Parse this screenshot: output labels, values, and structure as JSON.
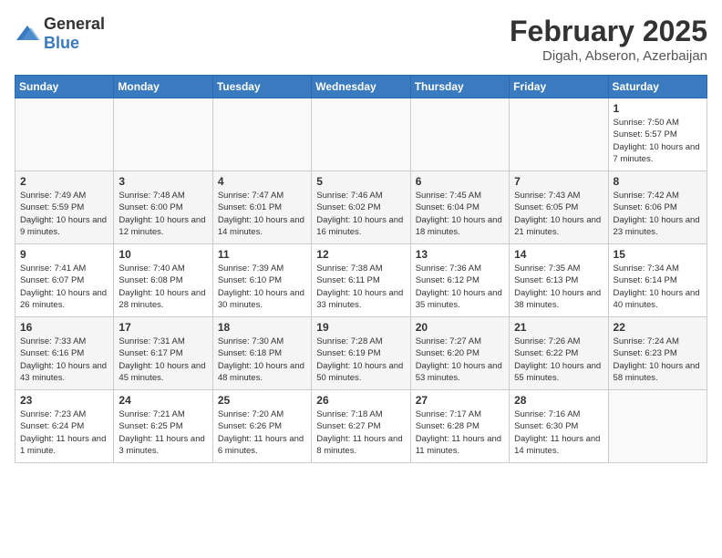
{
  "header": {
    "logo_general": "General",
    "logo_blue": "Blue",
    "title": "February 2025",
    "location": "Digah, Abseron, Azerbaijan"
  },
  "calendar": {
    "weekdays": [
      "Sunday",
      "Monday",
      "Tuesday",
      "Wednesday",
      "Thursday",
      "Friday",
      "Saturday"
    ],
    "weeks": [
      [
        {
          "day": "",
          "sunrise": "",
          "sunset": "",
          "daylight": "",
          "empty": true
        },
        {
          "day": "",
          "sunrise": "",
          "sunset": "",
          "daylight": "",
          "empty": true
        },
        {
          "day": "",
          "sunrise": "",
          "sunset": "",
          "daylight": "",
          "empty": true
        },
        {
          "day": "",
          "sunrise": "",
          "sunset": "",
          "daylight": "",
          "empty": true
        },
        {
          "day": "",
          "sunrise": "",
          "sunset": "",
          "daylight": "",
          "empty": true
        },
        {
          "day": "",
          "sunrise": "",
          "sunset": "",
          "daylight": "",
          "empty": true
        },
        {
          "day": "1",
          "sunrise": "Sunrise: 7:50 AM",
          "sunset": "Sunset: 5:57 PM",
          "daylight": "Daylight: 10 hours and 7 minutes.",
          "empty": false
        }
      ],
      [
        {
          "day": "2",
          "sunrise": "Sunrise: 7:49 AM",
          "sunset": "Sunset: 5:59 PM",
          "daylight": "Daylight: 10 hours and 9 minutes.",
          "empty": false
        },
        {
          "day": "3",
          "sunrise": "Sunrise: 7:48 AM",
          "sunset": "Sunset: 6:00 PM",
          "daylight": "Daylight: 10 hours and 12 minutes.",
          "empty": false
        },
        {
          "day": "4",
          "sunrise": "Sunrise: 7:47 AM",
          "sunset": "Sunset: 6:01 PM",
          "daylight": "Daylight: 10 hours and 14 minutes.",
          "empty": false
        },
        {
          "day": "5",
          "sunrise": "Sunrise: 7:46 AM",
          "sunset": "Sunset: 6:02 PM",
          "daylight": "Daylight: 10 hours and 16 minutes.",
          "empty": false
        },
        {
          "day": "6",
          "sunrise": "Sunrise: 7:45 AM",
          "sunset": "Sunset: 6:04 PM",
          "daylight": "Daylight: 10 hours and 18 minutes.",
          "empty": false
        },
        {
          "day": "7",
          "sunrise": "Sunrise: 7:43 AM",
          "sunset": "Sunset: 6:05 PM",
          "daylight": "Daylight: 10 hours and 21 minutes.",
          "empty": false
        },
        {
          "day": "8",
          "sunrise": "Sunrise: 7:42 AM",
          "sunset": "Sunset: 6:06 PM",
          "daylight": "Daylight: 10 hours and 23 minutes.",
          "empty": false
        }
      ],
      [
        {
          "day": "9",
          "sunrise": "Sunrise: 7:41 AM",
          "sunset": "Sunset: 6:07 PM",
          "daylight": "Daylight: 10 hours and 26 minutes.",
          "empty": false
        },
        {
          "day": "10",
          "sunrise": "Sunrise: 7:40 AM",
          "sunset": "Sunset: 6:08 PM",
          "daylight": "Daylight: 10 hours and 28 minutes.",
          "empty": false
        },
        {
          "day": "11",
          "sunrise": "Sunrise: 7:39 AM",
          "sunset": "Sunset: 6:10 PM",
          "daylight": "Daylight: 10 hours and 30 minutes.",
          "empty": false
        },
        {
          "day": "12",
          "sunrise": "Sunrise: 7:38 AM",
          "sunset": "Sunset: 6:11 PM",
          "daylight": "Daylight: 10 hours and 33 minutes.",
          "empty": false
        },
        {
          "day": "13",
          "sunrise": "Sunrise: 7:36 AM",
          "sunset": "Sunset: 6:12 PM",
          "daylight": "Daylight: 10 hours and 35 minutes.",
          "empty": false
        },
        {
          "day": "14",
          "sunrise": "Sunrise: 7:35 AM",
          "sunset": "Sunset: 6:13 PM",
          "daylight": "Daylight: 10 hours and 38 minutes.",
          "empty": false
        },
        {
          "day": "15",
          "sunrise": "Sunrise: 7:34 AM",
          "sunset": "Sunset: 6:14 PM",
          "daylight": "Daylight: 10 hours and 40 minutes.",
          "empty": false
        }
      ],
      [
        {
          "day": "16",
          "sunrise": "Sunrise: 7:33 AM",
          "sunset": "Sunset: 6:16 PM",
          "daylight": "Daylight: 10 hours and 43 minutes.",
          "empty": false
        },
        {
          "day": "17",
          "sunrise": "Sunrise: 7:31 AM",
          "sunset": "Sunset: 6:17 PM",
          "daylight": "Daylight: 10 hours and 45 minutes.",
          "empty": false
        },
        {
          "day": "18",
          "sunrise": "Sunrise: 7:30 AM",
          "sunset": "Sunset: 6:18 PM",
          "daylight": "Daylight: 10 hours and 48 minutes.",
          "empty": false
        },
        {
          "day": "19",
          "sunrise": "Sunrise: 7:28 AM",
          "sunset": "Sunset: 6:19 PM",
          "daylight": "Daylight: 10 hours and 50 minutes.",
          "empty": false
        },
        {
          "day": "20",
          "sunrise": "Sunrise: 7:27 AM",
          "sunset": "Sunset: 6:20 PM",
          "daylight": "Daylight: 10 hours and 53 minutes.",
          "empty": false
        },
        {
          "day": "21",
          "sunrise": "Sunrise: 7:26 AM",
          "sunset": "Sunset: 6:22 PM",
          "daylight": "Daylight: 10 hours and 55 minutes.",
          "empty": false
        },
        {
          "day": "22",
          "sunrise": "Sunrise: 7:24 AM",
          "sunset": "Sunset: 6:23 PM",
          "daylight": "Daylight: 10 hours and 58 minutes.",
          "empty": false
        }
      ],
      [
        {
          "day": "23",
          "sunrise": "Sunrise: 7:23 AM",
          "sunset": "Sunset: 6:24 PM",
          "daylight": "Daylight: 11 hours and 1 minute.",
          "empty": false
        },
        {
          "day": "24",
          "sunrise": "Sunrise: 7:21 AM",
          "sunset": "Sunset: 6:25 PM",
          "daylight": "Daylight: 11 hours and 3 minutes.",
          "empty": false
        },
        {
          "day": "25",
          "sunrise": "Sunrise: 7:20 AM",
          "sunset": "Sunset: 6:26 PM",
          "daylight": "Daylight: 11 hours and 6 minutes.",
          "empty": false
        },
        {
          "day": "26",
          "sunrise": "Sunrise: 7:18 AM",
          "sunset": "Sunset: 6:27 PM",
          "daylight": "Daylight: 11 hours and 8 minutes.",
          "empty": false
        },
        {
          "day": "27",
          "sunrise": "Sunrise: 7:17 AM",
          "sunset": "Sunset: 6:28 PM",
          "daylight": "Daylight: 11 hours and 11 minutes.",
          "empty": false
        },
        {
          "day": "28",
          "sunrise": "Sunrise: 7:16 AM",
          "sunset": "Sunset: 6:30 PM",
          "daylight": "Daylight: 11 hours and 14 minutes.",
          "empty": false
        },
        {
          "day": "",
          "sunrise": "",
          "sunset": "",
          "daylight": "",
          "empty": true
        }
      ]
    ]
  }
}
